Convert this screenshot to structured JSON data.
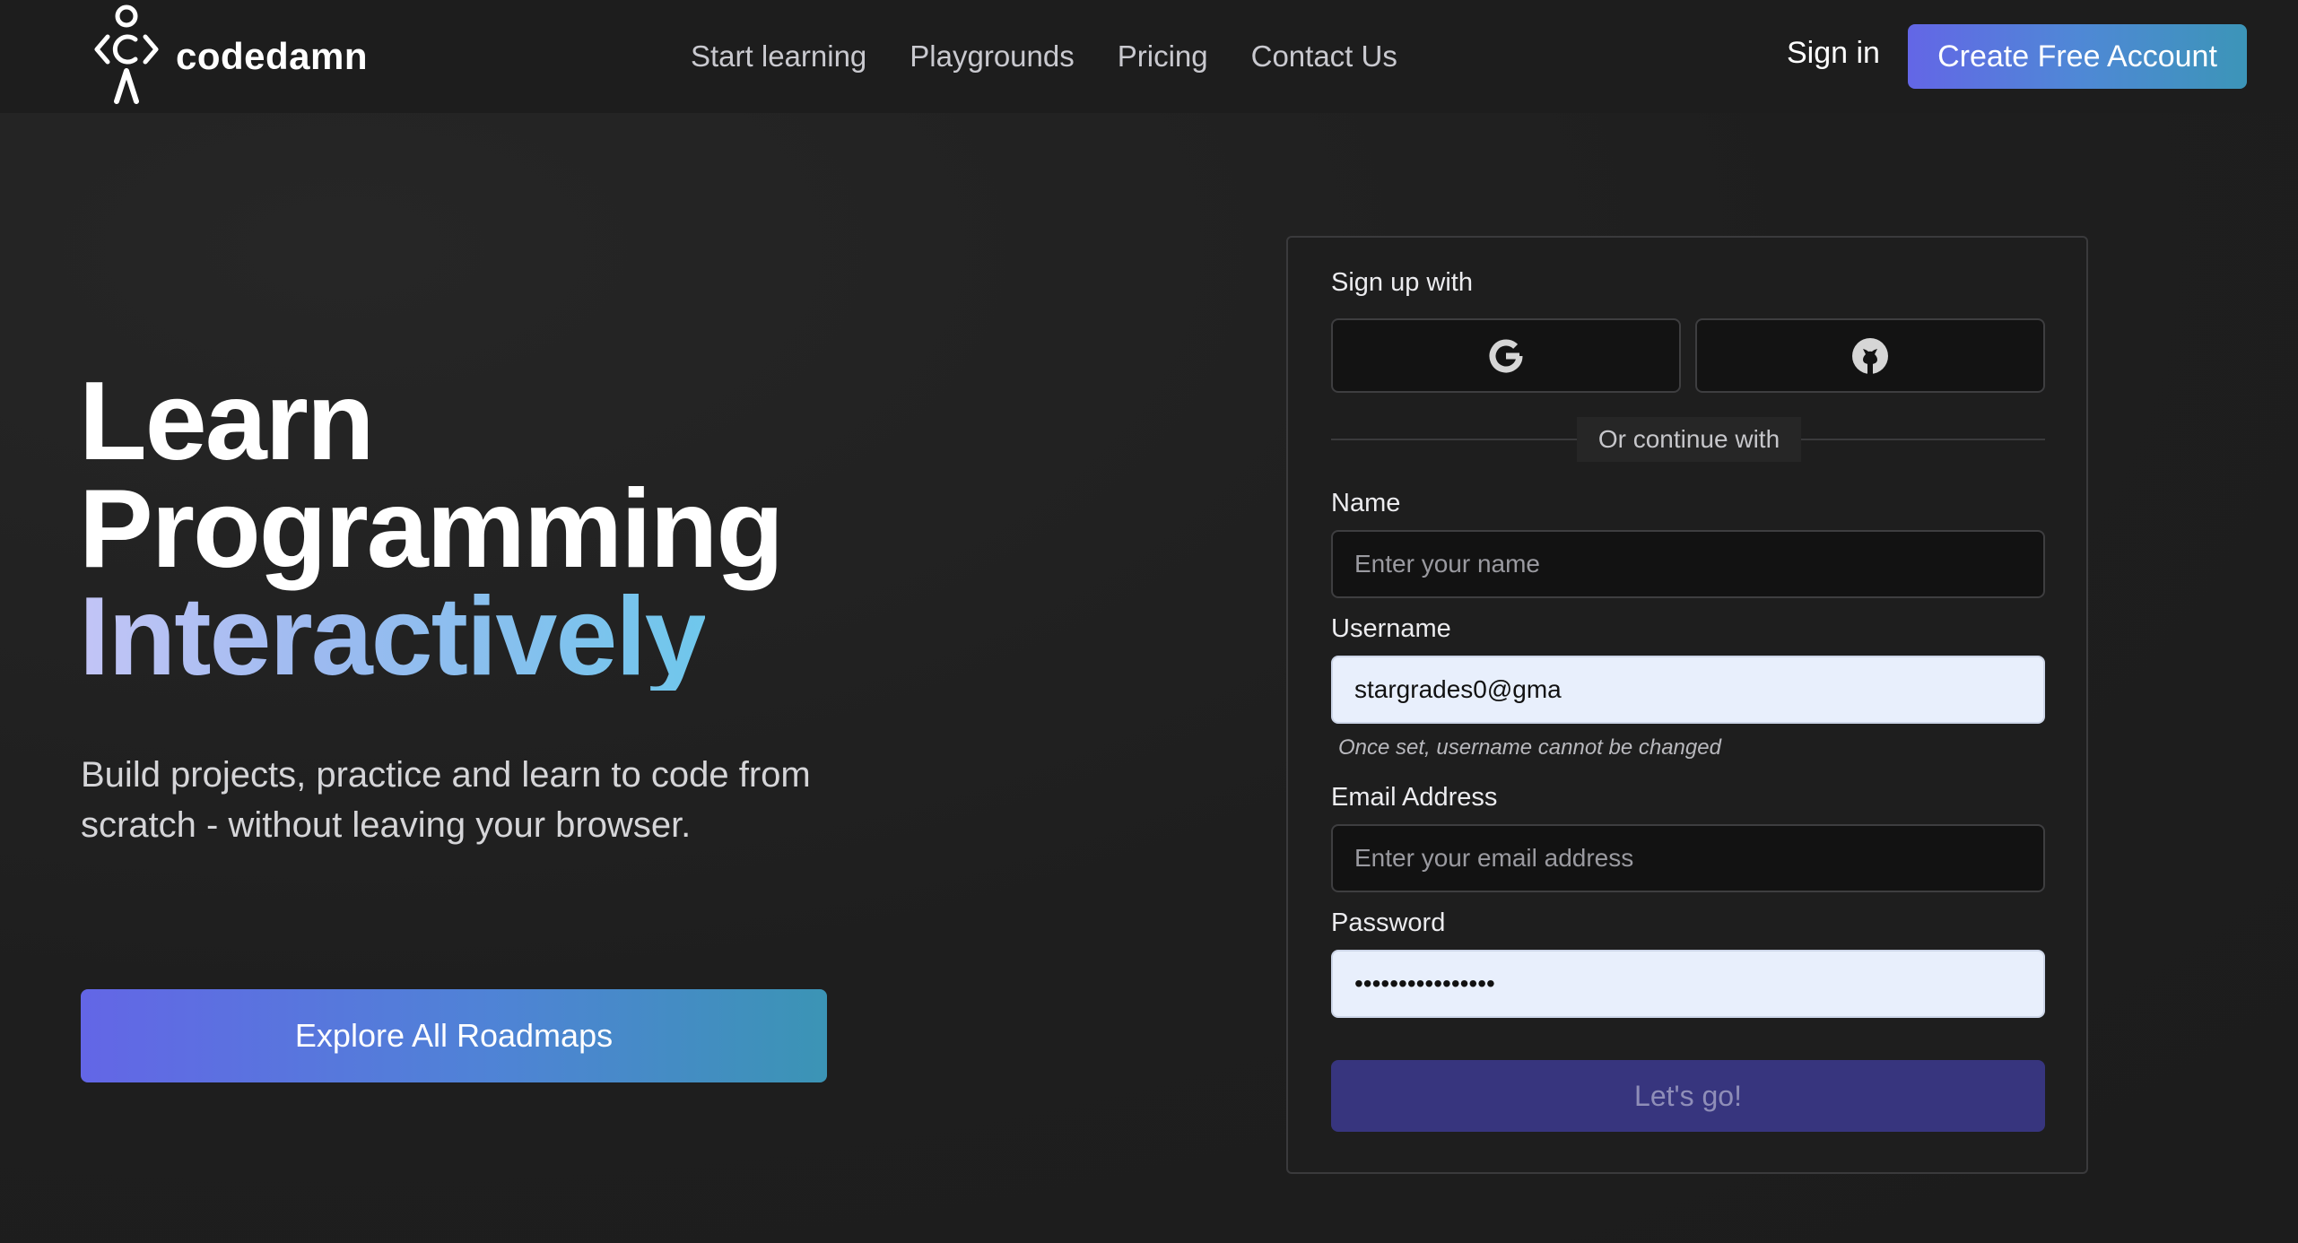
{
  "nav": {
    "logo_text": "codedamn",
    "links": [
      {
        "label": "Start learning"
      },
      {
        "label": "Playgrounds"
      },
      {
        "label": "Pricing"
      },
      {
        "label": "Contact Us"
      }
    ],
    "signin_label": "Sign in",
    "cta_label": "Create Free Account"
  },
  "hero": {
    "title_line1": "Learn",
    "title_line2": "Programming",
    "title_line3": "Interactively",
    "subtitle": "Build projects, practice and learn to code from scratch - without leaving your browser.",
    "button_label": "Explore All Roadmaps"
  },
  "form": {
    "signup_with_label": "Sign up with",
    "oauth": [
      {
        "provider": "google",
        "icon": "google-icon"
      },
      {
        "provider": "github",
        "icon": "github-icon"
      }
    ],
    "divider_text": "Or continue with",
    "name_label": "Name",
    "name_placeholder": "Enter your name",
    "name_value": "",
    "username_label": "Username",
    "username_value": "stargrades0@gma",
    "username_hint": "Once set, username cannot be changed",
    "email_label": "Email Address",
    "email_placeholder": "Enter your email address",
    "email_value": "",
    "password_label": "Password",
    "password_value": "••••••••••••••••",
    "submit_label": "Let's go!"
  },
  "colors": {
    "background": "#1f1f1f",
    "accent_start": "#6366e6",
    "accent_end": "#3c95b8",
    "submit_bg": "#37357e",
    "autofill_bg": "#e8effc"
  }
}
